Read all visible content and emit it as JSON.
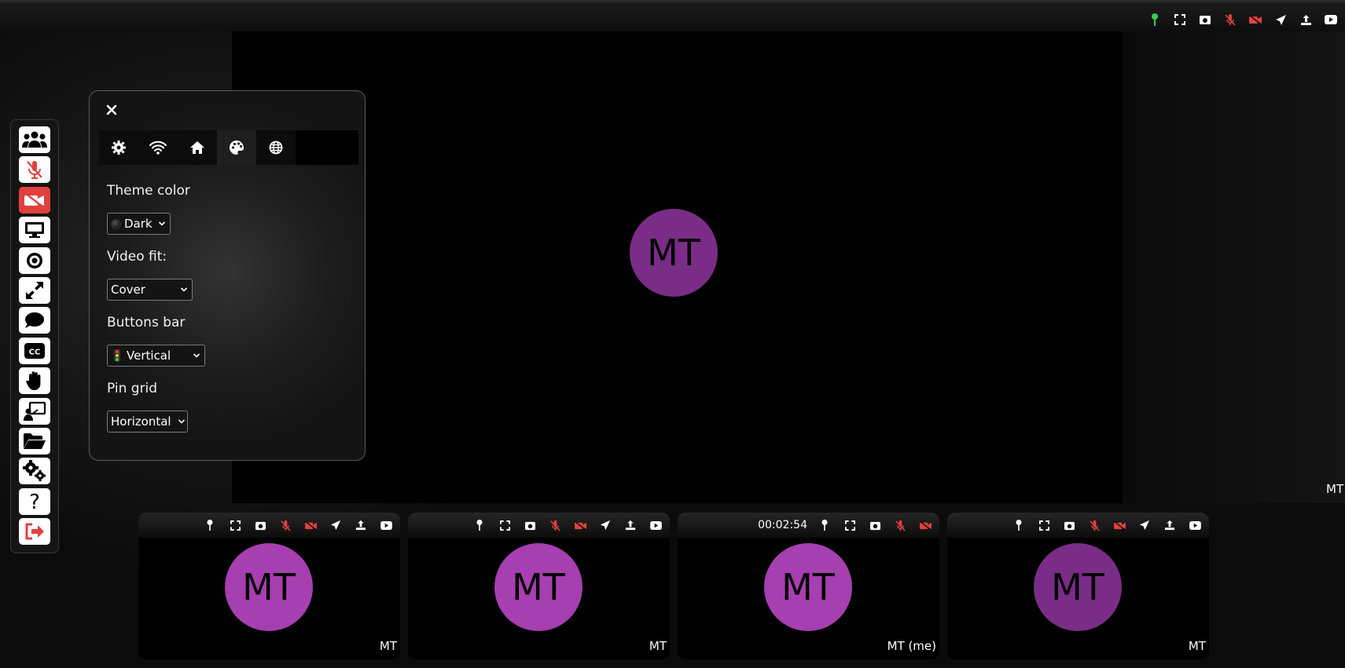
{
  "colors": {
    "avatar_main": "#7a2d86",
    "avatar_tile": "#a63fb0",
    "avatar_tile_dim": "#7a2d86",
    "mute_red": "#e0413f",
    "pin_green": "#37d04a"
  },
  "main_video": {
    "initials": "MT",
    "name": "MT"
  },
  "top_toolbar": {
    "icons": [
      "pin-icon",
      "fullscreen-icon",
      "snapshot-icon",
      "mic-off-icon",
      "video-off-icon",
      "send-icon",
      "upload-icon",
      "youtube-icon"
    ]
  },
  "left_toolbar": {
    "icons": [
      "participants-icon",
      "mic-off-icon",
      "video-off-icon",
      "screen-share-icon",
      "record-icon",
      "fullscreen-icon",
      "chat-icon",
      "captions-icon",
      "raise-hand-icon",
      "whiteboard-icon",
      "file-share-icon",
      "settings-icon",
      "help-icon",
      "leave-icon"
    ]
  },
  "settings_panel": {
    "close_icon": "close-icon",
    "tabs": [
      "settings-tab",
      "network-tab",
      "room-tab",
      "theme-tab",
      "language-tab"
    ],
    "theme_color_label": "Theme color",
    "theme_color_value": "Dark",
    "video_fit_label": "Video fit:",
    "video_fit_value": "Cover",
    "buttons_bar_label": "Buttons bar",
    "buttons_bar_value": "Vertical",
    "pin_grid_label": "Pin grid",
    "pin_grid_value": "Horizontal"
  },
  "tiles": [
    {
      "initials": "MT",
      "name": "MT"
    },
    {
      "initials": "MT",
      "name": "MT"
    },
    {
      "initials": "MT",
      "name": "MT (me)",
      "timer": "00:02:54"
    },
    {
      "initials": "MT",
      "name": "MT"
    }
  ]
}
